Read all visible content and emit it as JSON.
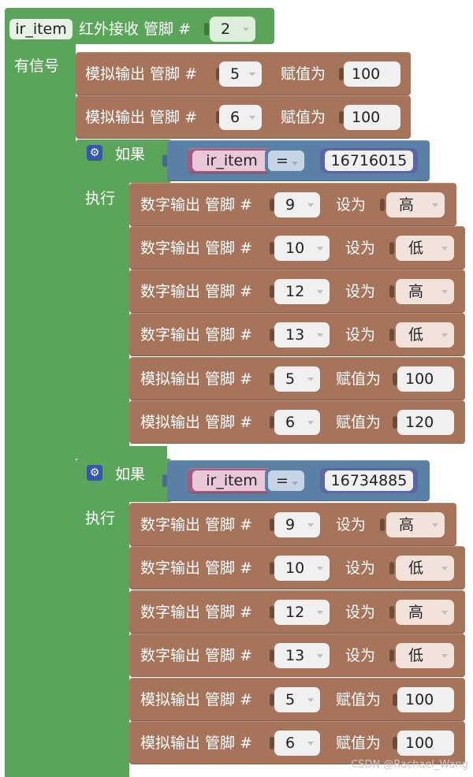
{
  "hat": {
    "var_name": "ir_item",
    "label": "红外接收 管脚 #",
    "pin": "2",
    "has_signal_label": "有信号"
  },
  "top_analog": [
    {
      "label": "模拟输出 管脚 #",
      "pin": "5",
      "assign_label": "赋值为",
      "value": "100"
    },
    {
      "label": "模拟输出 管脚 #",
      "pin": "6",
      "assign_label": "赋值为",
      "value": "100"
    }
  ],
  "if_blocks": [
    {
      "if_label": "如果",
      "do_label": "执行",
      "cond_var": "ir_item",
      "cond_op": "=",
      "cond_value": "16716015",
      "statements": [
        {
          "type": "digital",
          "label": "数字输出 管脚 #",
          "pin": "9",
          "set_label": "设为",
          "value": "高"
        },
        {
          "type": "digital",
          "label": "数字输出 管脚 #",
          "pin": "10",
          "set_label": "设为",
          "value": "低"
        },
        {
          "type": "digital",
          "label": "数字输出 管脚 #",
          "pin": "12",
          "set_label": "设为",
          "value": "高"
        },
        {
          "type": "digital",
          "label": "数字输出 管脚 #",
          "pin": "13",
          "set_label": "设为",
          "value": "低"
        },
        {
          "type": "analog",
          "label": "模拟输出 管脚 #",
          "pin": "5",
          "set_label": "赋值为",
          "value": "100"
        },
        {
          "type": "analog",
          "label": "模拟输出 管脚 #",
          "pin": "6",
          "set_label": "赋值为",
          "value": "120"
        }
      ]
    },
    {
      "if_label": "如果",
      "do_label": "执行",
      "cond_var": "ir_item",
      "cond_op": "=",
      "cond_value": "16734885",
      "statements": [
        {
          "type": "digital",
          "label": "数字输出 管脚 #",
          "pin": "9",
          "set_label": "设为",
          "value": "高"
        },
        {
          "type": "digital",
          "label": "数字输出 管脚 #",
          "pin": "10",
          "set_label": "设为",
          "value": "低"
        },
        {
          "type": "digital",
          "label": "数字输出 管脚 #",
          "pin": "12",
          "set_label": "设为",
          "value": "高"
        },
        {
          "type": "digital",
          "label": "数字输出 管脚 #",
          "pin": "13",
          "set_label": "设为",
          "value": "低"
        },
        {
          "type": "analog",
          "label": "模拟输出 管脚 #",
          "pin": "5",
          "set_label": "赋值为",
          "value": "100"
        },
        {
          "type": "analog",
          "label": "模拟输出 管脚 #",
          "pin": "6",
          "set_label": "赋值为",
          "value": "100"
        }
      ]
    }
  ],
  "watermark": "CSDN @Rachael_Wang",
  "colors": {
    "hat_green": "#5ba55b",
    "io_brown": "#a5745b",
    "logic_steel": "#5b80a5",
    "variable_pink": "#a55b80",
    "number_blue": "#5b67a5"
  }
}
